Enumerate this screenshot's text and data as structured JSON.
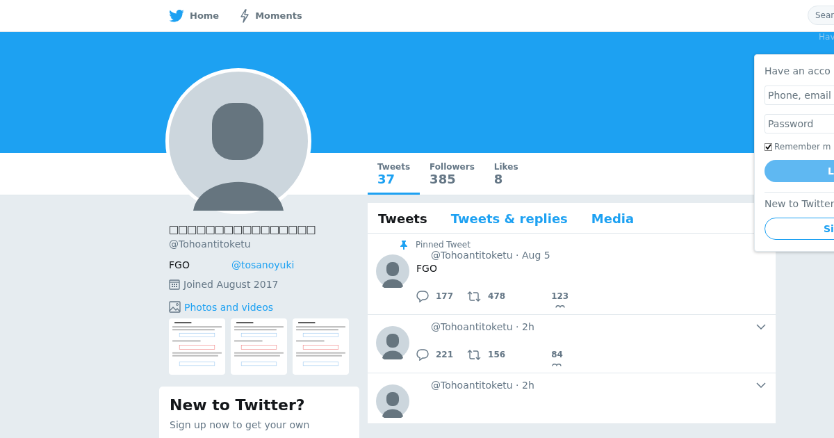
{
  "nav": {
    "items": [
      {
        "label": "Home"
      },
      {
        "label": "Moments"
      }
    ],
    "search": {
      "placeholder": "Sear"
    },
    "hint": "Hav"
  },
  "stats": [
    {
      "label": "Tweets",
      "value": "37",
      "selected": true
    },
    {
      "label": "Followers",
      "value": "385",
      "selected": false
    },
    {
      "label": "Likes",
      "value": "8",
      "selected": false
    }
  ],
  "profile": {
    "name": "□□□□□□□□□□□□□□□□",
    "handle": "@Tohoantitoketu",
    "bio": "FGO",
    "link": "@tosanoyuki",
    "joined": "Joined August 2017",
    "photos_link": "Photos and videos"
  },
  "signup_card": {
    "title": "New to Twitter?",
    "text": "Sign up now to get your own"
  },
  "timeline": {
    "tabs": [
      {
        "label": "Tweets",
        "selected": true
      },
      {
        "label": "Tweets & replies",
        "selected": false
      },
      {
        "label": "Media",
        "selected": false
      }
    ],
    "tweets": [
      {
        "pinned": true,
        "pinned_label": "Pinned Tweet",
        "byline": "@Tohoantitoketu · Aug 5",
        "text": "FGO",
        "replies": "177",
        "retweets": "478",
        "likes": "123",
        "menu": false
      },
      {
        "pinned": false,
        "byline": "@Tohoantitoketu · 2h",
        "replies": "221",
        "retweets": "156",
        "likes": "84",
        "menu": true
      },
      {
        "pinned": false,
        "byline": "@Tohoantitoketu · 2h",
        "menu": true
      }
    ]
  },
  "login": {
    "title": "Have an acco",
    "username": {
      "placeholder": "Phone, email"
    },
    "password": {
      "placeholder": "Password"
    },
    "remember": {
      "label": "Remember m",
      "checked": true
    },
    "login_button": "L",
    "signup_prompt": "New to Twitter",
    "signup_button": "Si"
  }
}
